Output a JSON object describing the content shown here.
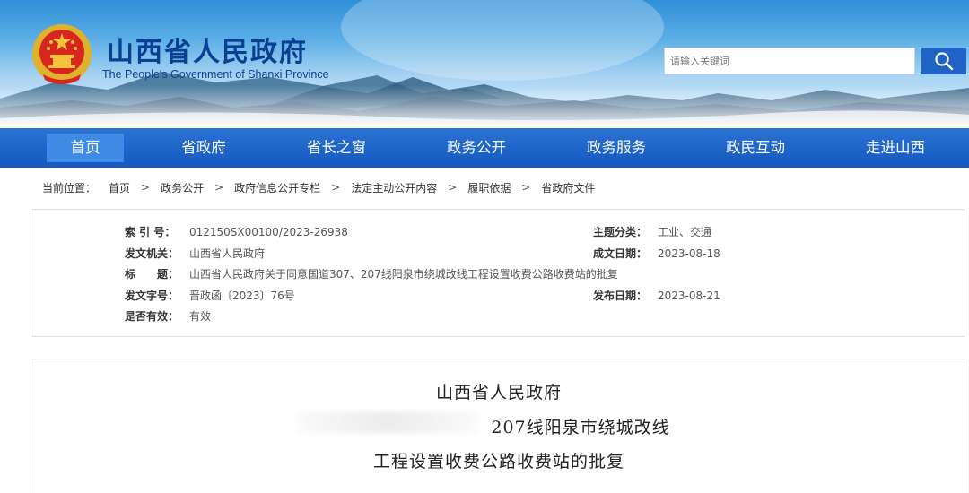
{
  "header": {
    "title": "山西省人民政府",
    "subtitle": "The People's Government of Shanxi Province",
    "search_placeholder": "请输入关键词",
    "colors": {
      "brand_blue": "#0b3f91",
      "nav_blue": "#1a5fc4",
      "active_tab": "#3e8ae5"
    }
  },
  "nav": {
    "items": [
      {
        "label": "首页",
        "active": true
      },
      {
        "label": "省政府"
      },
      {
        "label": "省长之窗"
      },
      {
        "label": "政务公开"
      },
      {
        "label": "政务服务"
      },
      {
        "label": "政民互动"
      },
      {
        "label": "走进山西"
      }
    ]
  },
  "breadcrumb": {
    "lead": "当前位置：",
    "items": [
      "首页",
      "政务公开",
      "政府信息公开专栏",
      "法定主动公开内容",
      "履职依据",
      "省政府文件"
    ],
    "separator": ">"
  },
  "meta": {
    "index_label": "索 引 号：",
    "index_value": "012150SX00100/2023-26938",
    "topic_label": "主题分类：",
    "topic_value": "工业、交通",
    "issuer_label": "发文机关：",
    "issuer_value": "山西省人民政府",
    "created_label": "成文日期：",
    "created_value": "2023-08-18",
    "title_label": "标　　题：",
    "title_value": "山西省人民政府关于同意国道307、207线阳泉市绕城改线工程设置收费公路收费站的批复",
    "docno_label": "发文字号：",
    "docno_value": "晋政函〔2023〕76号",
    "published_label": "发布日期：",
    "published_value": "2023-08-21",
    "valid_label": "是否有效：",
    "valid_value": "有效"
  },
  "document": {
    "line1": "山西省人民政府",
    "line2": "207线阳泉市绕城改线",
    "line3": "工程设置收费公路收费站的批复"
  }
}
